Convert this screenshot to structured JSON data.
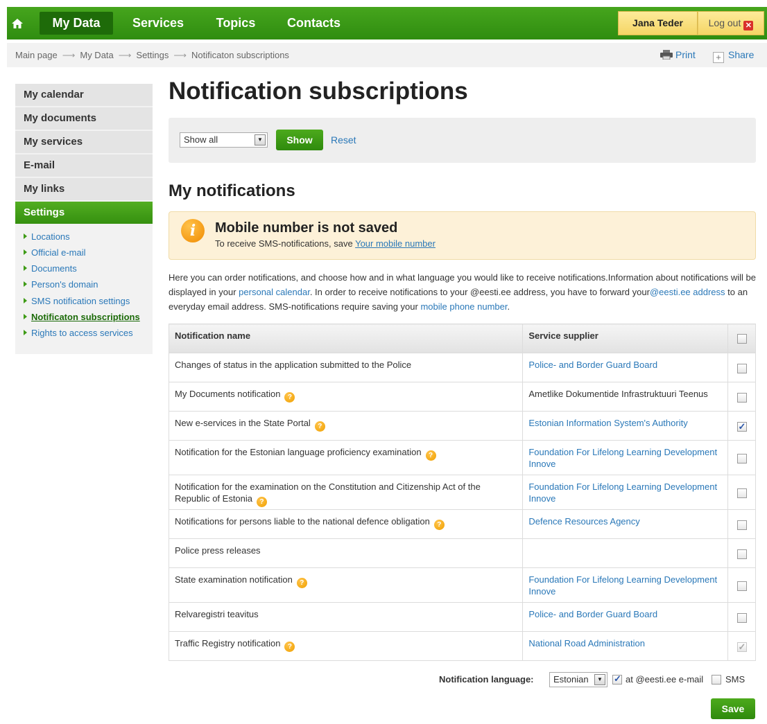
{
  "nav": {
    "items": [
      "My Data",
      "Services",
      "Topics",
      "Contacts"
    ],
    "user": "Jana Teder",
    "logout": "Log out"
  },
  "breadcrumb": [
    "Main page",
    "My Data",
    "Settings",
    "Notificaton subscriptions"
  ],
  "tools": {
    "print": "Print",
    "share": "Share"
  },
  "sidebar": {
    "items": [
      "My calendar",
      "My documents",
      "My services",
      "E-mail",
      "My links",
      "Settings"
    ],
    "sub_items": [
      "Locations",
      "Official e-mail",
      "Documents",
      "Person's domain",
      "SMS notification settings",
      "Notificaton subscriptions",
      "Rights to access services"
    ]
  },
  "page_title": "Notification subscriptions",
  "filter": {
    "selected": "Show all",
    "show_label": "Show",
    "reset_label": "Reset"
  },
  "section_title": "My notifications",
  "alert": {
    "title": "Mobile number is not saved",
    "text": "To receive SMS-notifications, save",
    "link": "Your mobile number"
  },
  "intro": {
    "p1": "Here you can order notifications, and choose how and in what language you would like to receive notifications.Information about notifications will be displayed in your ",
    "link1": "personal calendar",
    "p2": ". In order to receive notifications to your @eesti.ee address, you have to forward your",
    "link2": "@eesti.ee address",
    "p3": " to an everyday email address. SMS-notifications require saving your ",
    "link3": "mobile phone number",
    "p4": "."
  },
  "table": {
    "headers": [
      "Notification name",
      "Service supplier"
    ],
    "rows": [
      {
        "name": "Changes of status in the application submitted to the Police",
        "supplier": "Police- and Border Guard Board",
        "help": false,
        "checked": false
      },
      {
        "name": "My Documents notification",
        "supplier": "Ametlike Dokumentide Infrastruktuuri Teenus",
        "help": true,
        "checked": false
      },
      {
        "name": "New e-services in the State Portal",
        "supplier": "Estonian Information System's Authority",
        "help": true,
        "checked": true
      },
      {
        "name": "Notification for the Estonian language proficiency examination",
        "supplier": "Foundation For Lifelong Learning Development Innove",
        "help": true,
        "checked": false
      },
      {
        "name": "Notification for the examination on the Constitution and Citizenship Act of the Republic of Estonia",
        "supplier": "Foundation For Lifelong Learning Development Innove",
        "help": true,
        "checked": false
      },
      {
        "name": "Notifications for persons liable to the national defence obligation",
        "supplier": "Defence Resources Agency",
        "help": true,
        "checked": false
      },
      {
        "name": "Police press releases",
        "supplier": "",
        "help": false,
        "checked": false
      },
      {
        "name": "State examination notification",
        "supplier": "Foundation For Lifelong Learning Development Innove",
        "help": true,
        "checked": false
      },
      {
        "name": "Relvaregistri teavitus",
        "supplier": "Police- and Border Guard Board",
        "help": false,
        "checked": false
      },
      {
        "name": "Traffic Registry notification",
        "supplier": "National Road Administration",
        "help": true,
        "checked": true
      }
    ]
  },
  "footer": {
    "language_label": "Notification language:",
    "language": "Estonian",
    "email_label": "at @eesti.ee e-mail",
    "sms_label": "SMS",
    "save_label": "Save"
  },
  "colors": {
    "brand_green": "#3e9b16",
    "link_blue": "#2a78b8",
    "alert_bg": "#fdf1d8"
  },
  "icons": [
    "home-icon",
    "logout-x-icon",
    "printer-icon",
    "share-plus-icon",
    "info-icon",
    "help-icon"
  ]
}
